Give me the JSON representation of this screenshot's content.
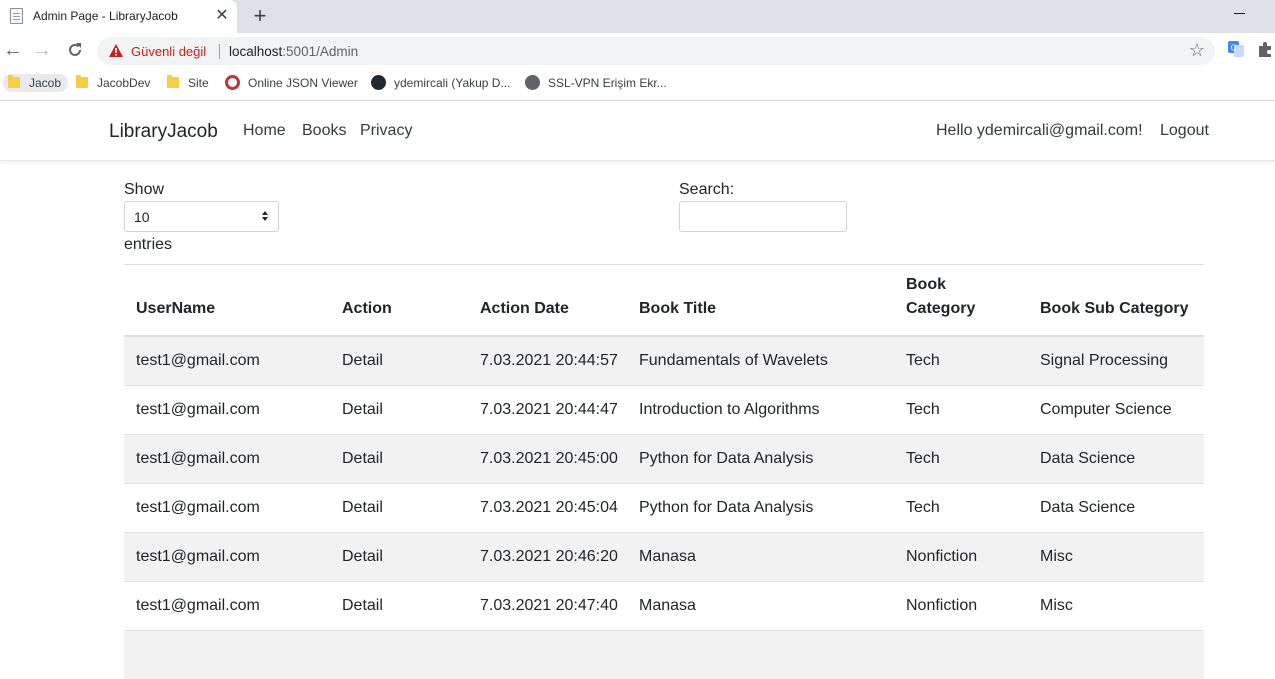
{
  "browser": {
    "tab_title": "Admin Page - LibraryJacob",
    "insecure_label": "Güvenli değil",
    "url_host": "localhost",
    "url_path": ":5001/Admin",
    "bookmarks": [
      "Jacob",
      "JacobDev",
      "Site",
      "Online JSON Viewer",
      "ydemircali (Yakup D...",
      "SSL-VPN Erişim Ekr..."
    ]
  },
  "navbar": {
    "brand": "LibraryJacob",
    "links": [
      "Home",
      "Books",
      "Privacy"
    ],
    "greeting": "Hello ydemircali@gmail.com!",
    "logout": "Logout"
  },
  "controls": {
    "show_label": "Show",
    "page_size": "10",
    "entries_label": "entries",
    "search_label": "Search:",
    "search_value": ""
  },
  "table": {
    "headers": [
      "UserName",
      "Action",
      "Action Date",
      "Book Title",
      "Book Category",
      "Book Sub Category"
    ],
    "rows": [
      [
        "test1@gmail.com",
        "Detail",
        "7.03.2021 20:44:57",
        "Fundamentals of Wavelets",
        "Tech",
        "Signal Processing"
      ],
      [
        "test1@gmail.com",
        "Detail",
        "7.03.2021 20:44:47",
        "Introduction to Algorithms",
        "Tech",
        "Computer Science"
      ],
      [
        "test1@gmail.com",
        "Detail",
        "7.03.2021 20:45:00",
        "Python for Data Analysis",
        "Tech",
        "Data Science"
      ],
      [
        "test1@gmail.com",
        "Detail",
        "7.03.2021 20:45:04",
        "Python for Data Analysis",
        "Tech",
        "Data Science"
      ],
      [
        "test1@gmail.com",
        "Detail",
        "7.03.2021 20:46:20",
        "Manasa",
        "Nonfiction",
        "Misc"
      ],
      [
        "test1@gmail.com",
        "Detail",
        "7.03.2021 20:47:40",
        "Manasa",
        "Nonfiction",
        "Misc"
      ]
    ]
  },
  "colors": {
    "insecure": "#c5221f",
    "stripe": "#f2f2f2",
    "folder": "#f7cd46"
  }
}
